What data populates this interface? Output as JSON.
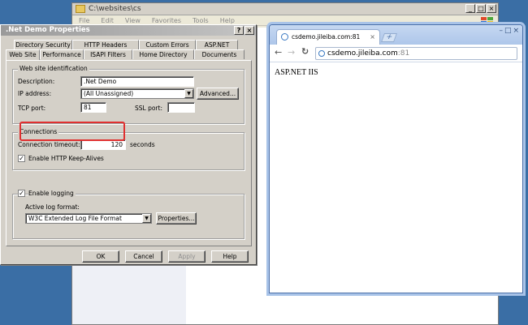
{
  "explorer": {
    "title": "C:\\websites\\cs",
    "menu": [
      "File",
      "Edit",
      "View",
      "Favorites",
      "Tools",
      "Help"
    ]
  },
  "dialog": {
    "title": ".Net Demo Properties",
    "tabs_row1": [
      "Directory Security",
      "HTTP Headers",
      "Custom Errors",
      "ASP.NET"
    ],
    "tabs_row2": [
      "Web Site",
      "Performance",
      "ISAPI Filters",
      "Home Directory",
      "Documents"
    ],
    "identification": {
      "legend": "Web site identification",
      "description_label": "Description:",
      "description_value": ".Net Demo",
      "ip_label": "IP address:",
      "ip_value": "(All Unassigned)",
      "advanced_button": "Advanced...",
      "tcp_label": "TCP port:",
      "tcp_value": "81",
      "ssl_label": "SSL port:",
      "ssl_value": ""
    },
    "connections": {
      "legend": "Connections",
      "timeout_label": "Connection timeout:",
      "timeout_value": "120",
      "timeout_unit": "seconds",
      "keepalive_label": "Enable HTTP Keep-Alives",
      "keepalive_checked": true
    },
    "logging": {
      "enable_label": "Enable logging",
      "enable_checked": true,
      "format_label": "Active log format:",
      "format_value": "W3C Extended Log File Format",
      "properties_button": "Properties..."
    },
    "buttons": {
      "ok": "OK",
      "cancel": "Cancel",
      "apply": "Apply",
      "help": "Help"
    }
  },
  "browser": {
    "tab_title": "csdemo.jileiba.com:81",
    "url_host": "csdemo.jileiba.com",
    "url_port": ":81",
    "page_text": "ASP.NET IIS"
  }
}
